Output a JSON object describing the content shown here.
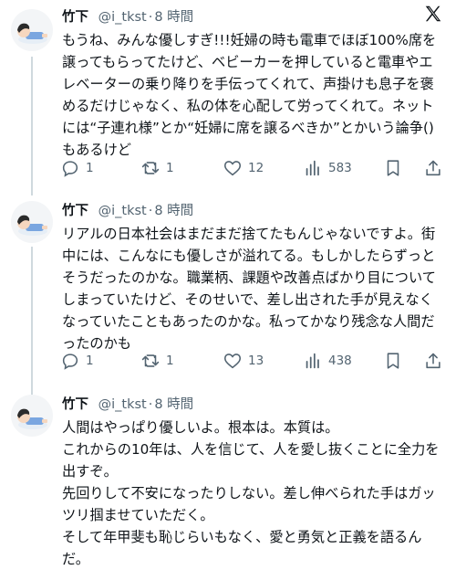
{
  "tweets": [
    {
      "name": "竹下",
      "handle": "@i_tkst",
      "separator": "·",
      "time": "8 時間",
      "text": "もうね、みんな優しすぎ!!!妊婦の時も電車でほぼ100%席を譲ってもらってたけど、ベビーカーを押していると電車やエレベーターの乗り降りを手伝ってくれて、声掛けも息子を褒めるだけじゃなく、私の体を心配して労ってくれて。ネットには“子連れ様”とか“妊婦に席を譲るべきか”とかいう論争()もあるけど",
      "replies": "1",
      "retweets": "1",
      "likes": "12",
      "views": "583"
    },
    {
      "name": "竹下",
      "handle": "@i_tkst",
      "separator": "·",
      "time": "8 時間",
      "text": "リアルの日本社会はまだまだ捨てたもんじゃないですよ。街中には、こんなにも優しさが溢れてる。もしかしたらずっとそうだったのかな。職業柄、課題や改善点ばかり目についてしまっていたけど、そのせいで、差し出された手が見えなくなっていたこともあったのかな。私ってかなり残念な人間だったのかも",
      "replies": "1",
      "retweets": "1",
      "likes": "13",
      "views": "438"
    },
    {
      "name": "竹下",
      "handle": "@i_tkst",
      "separator": "·",
      "time": "8 時間",
      "text": "人間はやっぱり優しいよ。根本は。本質は。\nこれからの10年は、人を信じて、人を愛し抜くことに全力を出すぞ。\n先回りして不安になったりしない。差し伸べられた手はガッツリ掴ませていただく。\nそして年甲斐も恥じらいもなく、愛と勇気と正義を語るんだ。"
    }
  ],
  "colors": {
    "text": "#0f1419",
    "secondary": "#536471",
    "thread_line": "#cfd9de"
  },
  "icons": [
    "x-logo-icon",
    "reply-icon",
    "retweet-icon",
    "like-icon",
    "views-icon",
    "bookmark-icon",
    "share-icon"
  ]
}
